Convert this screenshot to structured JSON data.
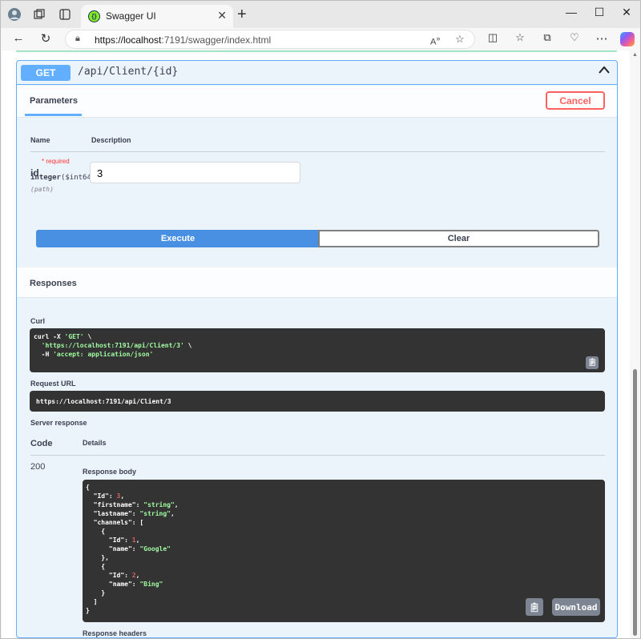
{
  "browser": {
    "tab_title": "Swagger UI",
    "tab_close": "✕",
    "new_tab": "+",
    "url_host": "https://localhost",
    "url_rest": ":7191/swagger/index.html",
    "window_minimize": "—",
    "window_maximize": "☐",
    "window_close": "✕"
  },
  "operation": {
    "method": "GET",
    "path": "/api/Client/{id}"
  },
  "parameters": {
    "tab_label": "Parameters",
    "cancel_label": "Cancel",
    "col_name": "Name",
    "col_description": "Description",
    "param_name": "id",
    "param_required_mark": "* required",
    "param_type": "integer",
    "param_format": "($int64)",
    "param_in": "(path)",
    "param_value": "3"
  },
  "actions": {
    "execute_label": "Execute",
    "clear_label": "Clear"
  },
  "responses": {
    "title": "Responses",
    "curl_label": "Curl",
    "curl_line1": "curl -X ",
    "curl_method": "'GET'",
    "curl_line1_end": " \\",
    "curl_url": "'https://localhost:7191/api/Client/3'",
    "curl_url_end": " \\",
    "curl_header_flag": "-H ",
    "curl_header": "'accept: application/json'",
    "request_url_label": "Request URL",
    "request_url": "https://localhost:7191/api/Client/3",
    "server_response_label": "Server response",
    "col_code": "Code",
    "col_details": "Details",
    "status_code": "200",
    "response_body_label": "Response body",
    "download_label": "Download",
    "response_headers_label": "Response headers"
  },
  "response_body": {
    "id": "3",
    "firstname": "\"string\"",
    "lastname": "\"string\"",
    "channel1_id": "1",
    "channel1_name": "\"Google\"",
    "channel2_id": "2",
    "channel2_name": "\"Bing\""
  }
}
